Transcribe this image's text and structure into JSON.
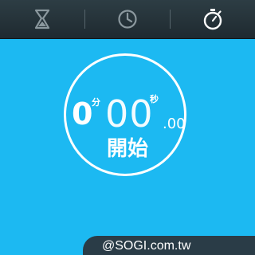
{
  "tabs": [
    {
      "icon": "hourglass-icon",
      "active": false
    },
    {
      "icon": "clock-icon",
      "active": false
    },
    {
      "icon": "stopwatch-icon",
      "active": true
    }
  ],
  "stopwatch": {
    "minutes": "0",
    "minutes_unit": "分",
    "seconds": "00",
    "seconds_unit": "秒",
    "fraction": ".00",
    "start_label": "開始"
  },
  "watermark": "@SOGI.com.tw",
  "colors": {
    "background": "#1cb9f2",
    "tabbar": "#263840",
    "icon_inactive": "#8b989e",
    "icon_active": "#ffffff",
    "foreground": "#ffffff"
  }
}
